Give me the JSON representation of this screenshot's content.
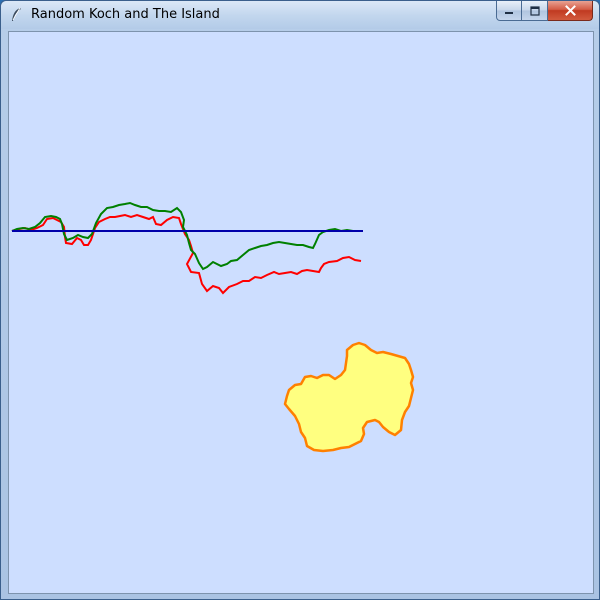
{
  "window": {
    "title": "Random Koch and The Island",
    "controls": {
      "minimize_icon": "minimize-icon",
      "maximize_icon": "maximize-icon",
      "close_icon": "close-icon"
    }
  },
  "canvas": {
    "background": "#cddeff",
    "colors": {
      "baseline": "#0000aa",
      "curve_red": "#ff0000",
      "curve_green": "#008000",
      "island_fill": "#ffff80",
      "island_outline": "#ff8000"
    }
  }
}
